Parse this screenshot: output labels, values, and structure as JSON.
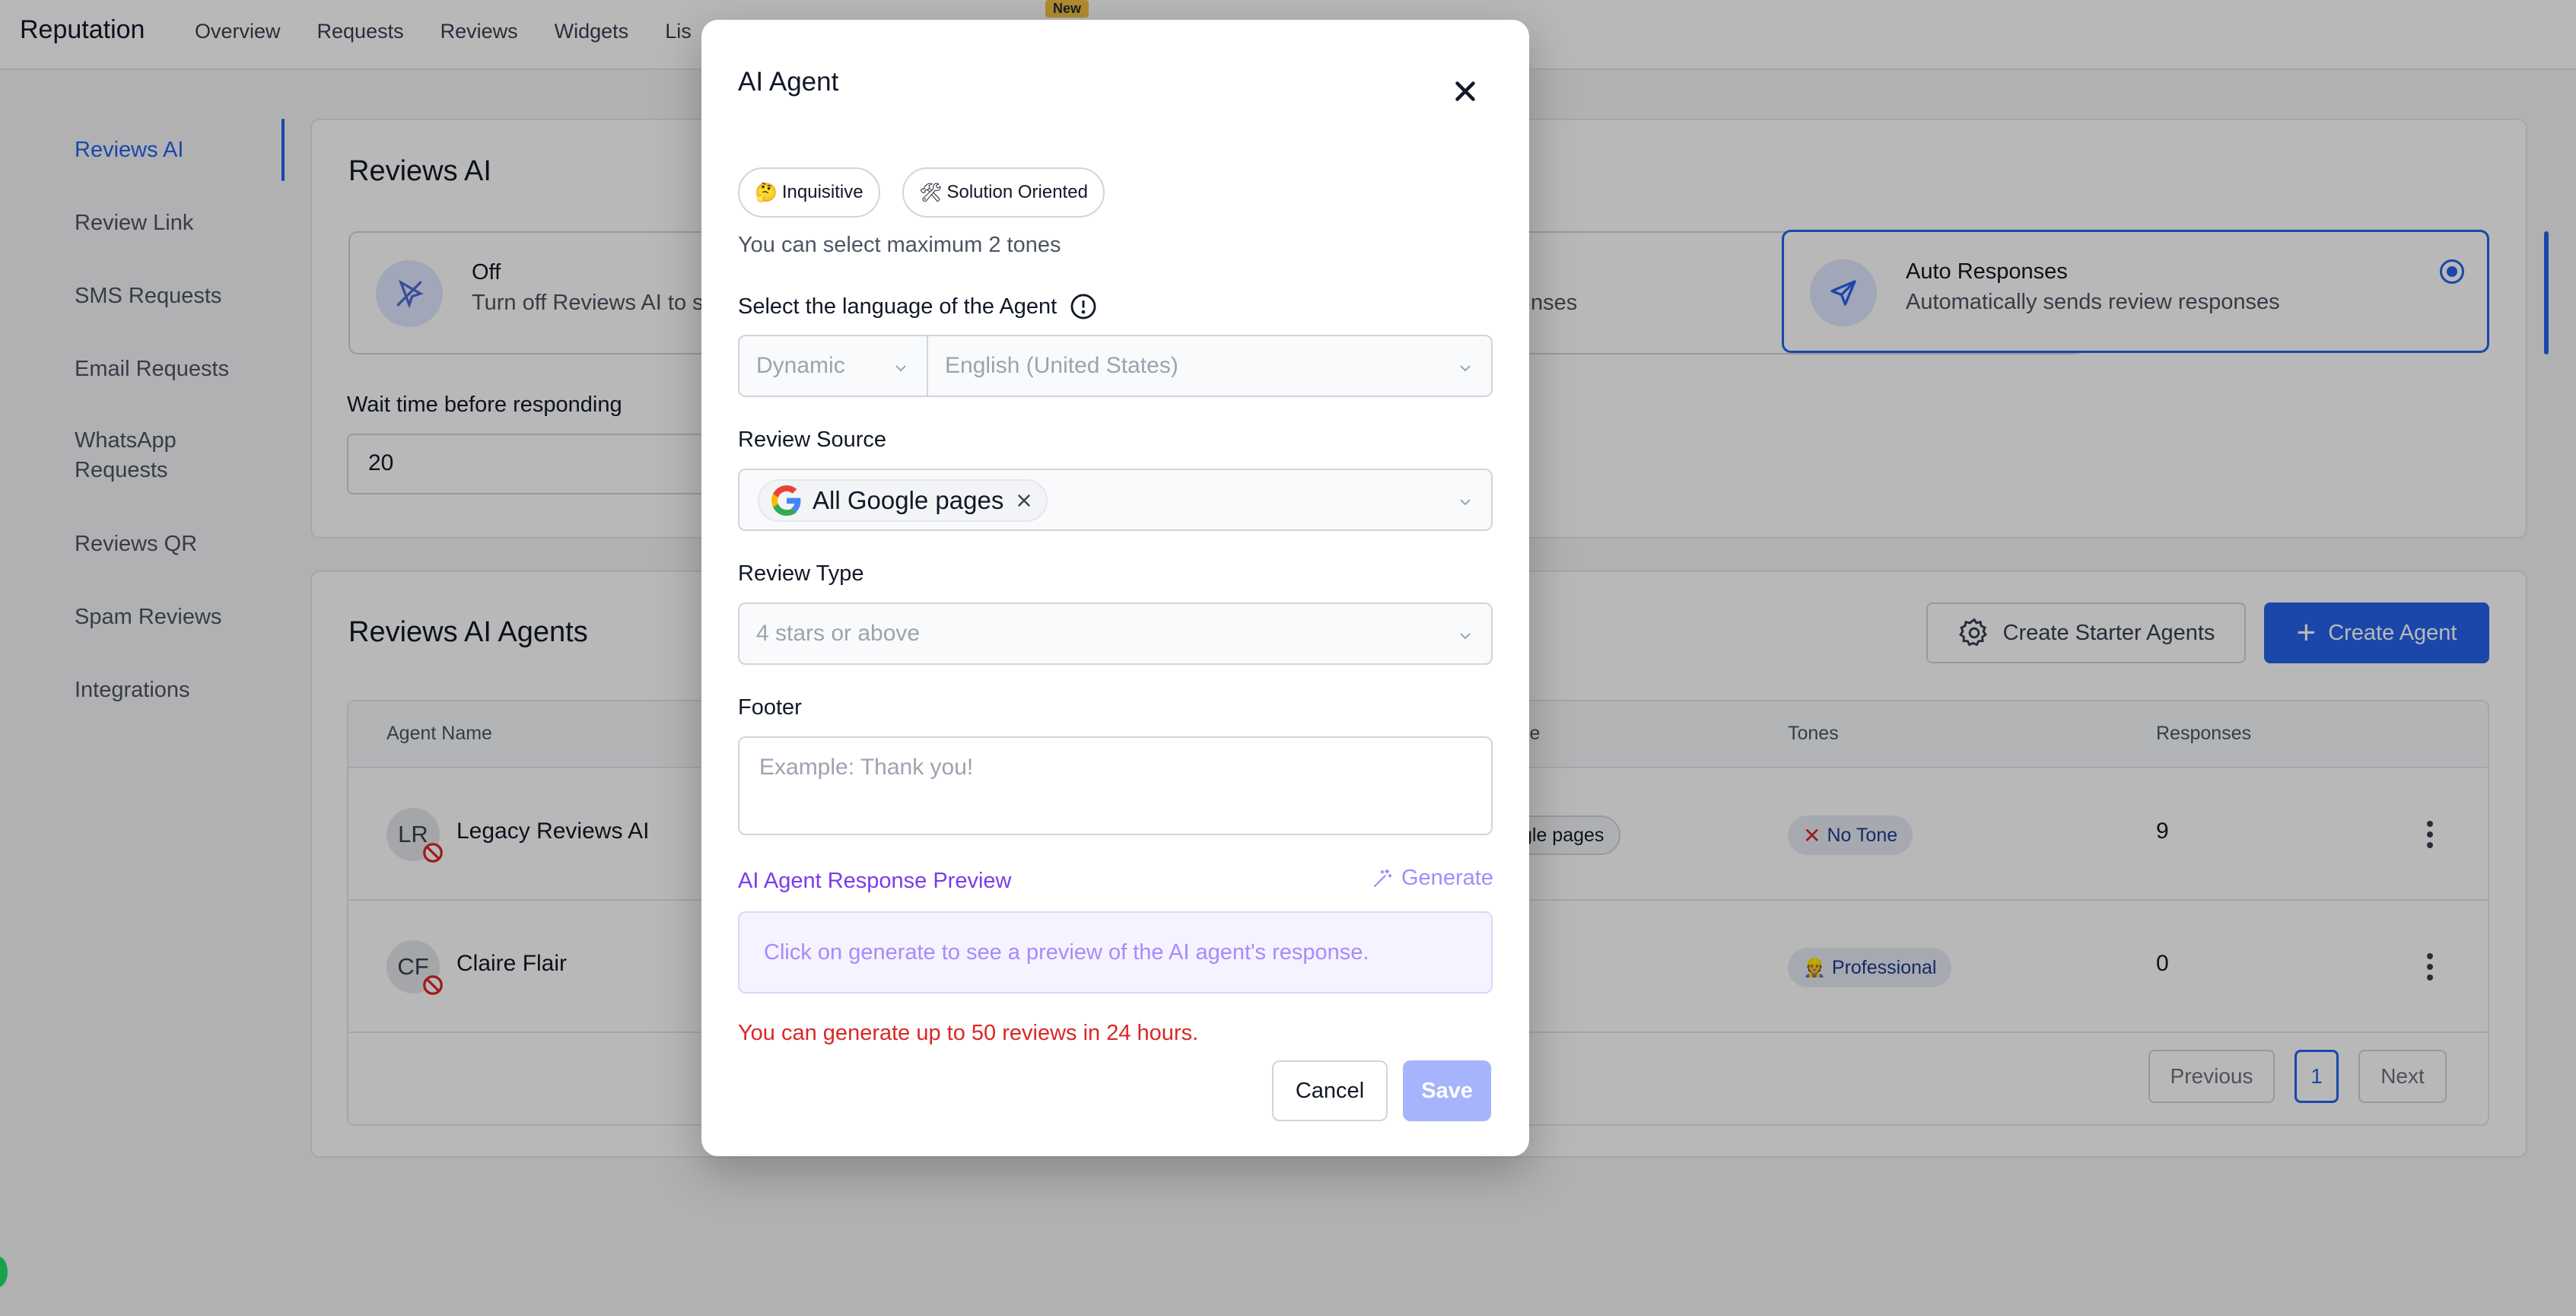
{
  "header": {
    "brand": "Reputation",
    "nav": [
      "Overview",
      "Requests",
      "Reviews",
      "Widgets",
      "Lis"
    ],
    "new_badge": "New"
  },
  "sidebar": {
    "items": [
      {
        "label": "Reviews AI"
      },
      {
        "label": "Review Link"
      },
      {
        "label": "SMS Requests"
      },
      {
        "label": "Email Requests"
      },
      {
        "label": "WhatsApp Requests"
      },
      {
        "label": "Reviews QR"
      },
      {
        "label": "Spam Reviews"
      },
      {
        "label": "Integrations"
      }
    ]
  },
  "reviews_ai": {
    "title": "Reviews AI",
    "modes": [
      {
        "title": "Off",
        "subtitle": "Turn off Reviews AI to s"
      },
      {
        "title": "",
        "subtitle": "nses"
      },
      {
        "title": "Auto Responses",
        "subtitle": "Automatically sends review responses"
      }
    ],
    "wait_label": "Wait time before responding",
    "wait_value": "20"
  },
  "agents": {
    "title": "Reviews AI Agents",
    "starter_button": "Create Starter Agents",
    "create_button": "Create Agent",
    "columns": [
      "Agent Name",
      "ce",
      "Tones",
      "Responses"
    ],
    "rows": [
      {
        "initials": "LR",
        "name": "Legacy Reviews AI",
        "source": "gle pages",
        "tone": "No Tone",
        "responses": "9"
      },
      {
        "initials": "CF",
        "name": "Claire Flair",
        "source": "",
        "tone": "Professional",
        "responses": "0"
      }
    ],
    "pager": {
      "previous": "Previous",
      "page": "1",
      "next": "Next"
    }
  },
  "modal": {
    "title": "AI Agent",
    "tones": [
      {
        "emoji": "🤔",
        "label": "Inquisitive"
      },
      {
        "emoji": "🛠",
        "label": "Solution Oriented"
      }
    ],
    "tone_hint": "You can select maximum 2 tones",
    "language_label": "Select the language of the Agent",
    "language_mode": "Dynamic",
    "language_value": "English (United States)",
    "source_label": "Review Source",
    "source_value": "All Google pages",
    "type_label": "Review Type",
    "type_value": "4 stars or above",
    "footer_label": "Footer",
    "footer_placeholder": "Example: Thank you!",
    "preview_label": "AI Agent Response Preview",
    "generate_label": "Generate",
    "preview_placeholder": "Click on generate to see a preview of the AI agent's response.",
    "limit_text": "You can generate up to 50 reviews in 24 hours.",
    "cancel": "Cancel",
    "save": "Save"
  },
  "colors": {
    "accent": "#2563eb",
    "preview_purple": "#7c3aed",
    "error_red": "#dc2626",
    "save_disabled": "#a5b4fc"
  }
}
